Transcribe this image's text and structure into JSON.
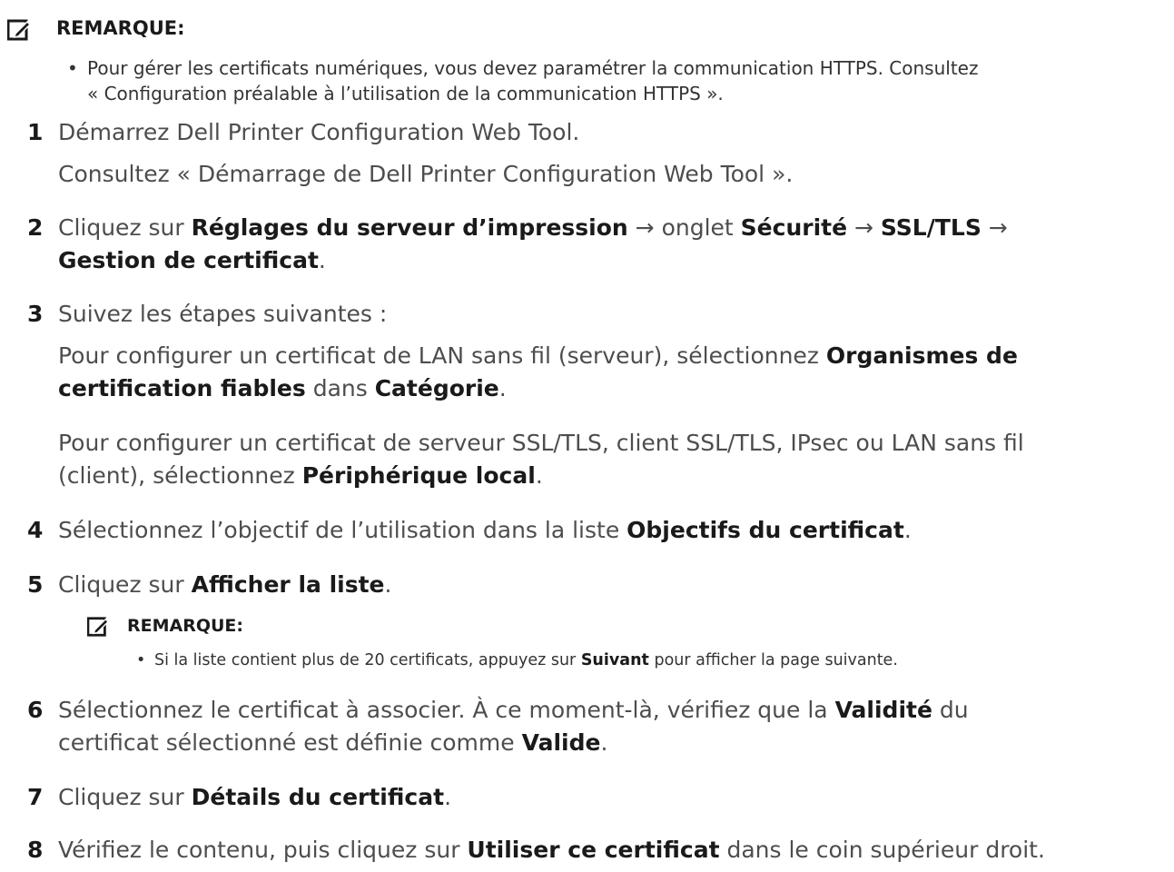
{
  "note1": {
    "title": "REMARQUE:",
    "bullet_line1": "Pour gérer les certificats numériques, vous devez paramétrer la communication HTTPS. Consultez",
    "bullet_line2": "« Configuration préalable à l’utilisation de la communication HTTPS »."
  },
  "steps": [
    {
      "num": "1",
      "line1": "Démarrez Dell Printer Configuration Web Tool.",
      "line2": "Consultez « Démarrage de Dell Printer Configuration Web Tool »."
    },
    {
      "num": "2",
      "p1": "Cliquez sur ",
      "b1": "Réglages du serveur d’impression",
      "p2": " → onglet ",
      "b2": "Sécurité",
      "p3": " → ",
      "b3": "SSL/TLS",
      "p4": " →",
      "b4": "Gestion de certificat",
      "p5": "."
    },
    {
      "num": "3",
      "line1": "Suivez les étapes suivantes :",
      "a1": "Pour configurer un certificat de LAN sans fil (serveur), sélectionnez ",
      "a2": "Organismes de",
      "a3": "certification fiables",
      "a4": " dans ",
      "a5": "Catégorie",
      "a6": ".",
      "c1": "Pour configurer un certificat de serveur SSL/TLS, client SSL/TLS, IPsec ou LAN sans fil",
      "c2": "(client), sélectionnez ",
      "c3": "Périphérique local",
      "c4": "."
    },
    {
      "num": "4",
      "p1": "Sélectionnez l’objectif de l’utilisation dans la liste ",
      "b1": "Objectifs du certificat",
      "p2": "."
    },
    {
      "num": "5",
      "p1": "Cliquez sur ",
      "b1": "Afficher la liste",
      "p2": "."
    },
    {
      "num": "6",
      "p1": "Sélectionnez le certificat à associer. À ce moment-là, vérifiez que la ",
      "b1": "Validité",
      "p2": " du",
      "p3": "certificat sélectionné est définie comme ",
      "b2": "Valide",
      "p4": "."
    },
    {
      "num": "7",
      "p1": "Cliquez sur ",
      "b1": "Détails du certificat",
      "p2": "."
    },
    {
      "num": "8",
      "p1": "Vérifiez le contenu, puis cliquez sur ",
      "b1": "Utiliser ce certificat",
      "p2": " dans le coin supérieur droit."
    }
  ],
  "note2": {
    "title": "REMARQUE:",
    "bullet_p1": "Si la liste contient plus de 20 certificats, appuyez sur ",
    "bullet_b1": "Suivant",
    "bullet_p2": " pour afficher la page suivante."
  },
  "icons": {
    "note": "pencil-note-icon"
  }
}
